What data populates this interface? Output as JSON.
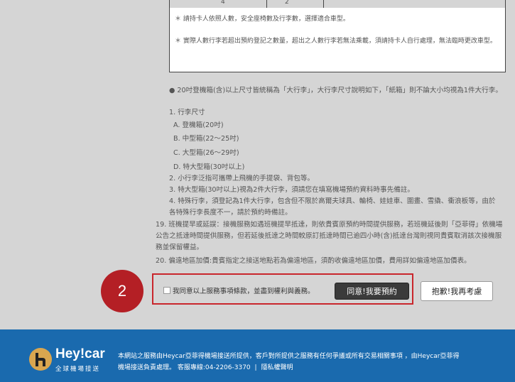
{
  "table": {
    "col2": "4",
    "col3": "2"
  },
  "notices": [
    "＊ 請持卡人依照人數，安全座椅數及行李數，選擇適合車型。",
    "＊ 實際人數行李若超出預約登記之數量，超出之人數行李若無法乘載，須請持卡人自行處理，無法臨時更改車型。"
  ],
  "rules": {
    "luggage_intro": "● 20吋登機箱(含)以上尺寸皆統稱為「大行李」，大行李尺寸說明如下，「紙箱」則不論大小均視為1件大行李。",
    "item1": "1. 行李尺寸",
    "item1a": "A. 登機箱(20吋)",
    "item1b": "B. 中型箱(22～25吋)",
    "item1c": "C. 大型箱(26～29吋)",
    "item1d": "D. 特大型箱(30吋以上)",
    "item2": "2. 小行李泛指可攜帶上飛機的手提袋、背包等。",
    "item3": "3. 特大型箱(30吋以上)視為2件大行李，須請您在填寫機場預約資料時事先備註。",
    "item4": "4. 特殊行李，須登記為1件大行李，包含但不限於高爾夫球具、輪椅、娃娃車、圍畫、雪撬、衝浪板等，由於各特殊行李長度不一，請於預約時備註。",
    "rule19": "19. 班機提早或延誤：接機服務如遇班機提早抵達，則依貴賓原預約時間提供服務，若班機延後則「亞菲得」依機場公告之抵達時間提供服務，但若延後抵達之時間較原訂抵達時間已逾四小時(含)抵達台灣則視同貴賓取消該次接機服務並保留權益。",
    "rule20": "20. 偏遠地區加價:貴賓指定之接送地點若為偏遠地區，須酌收偏遠地區加價，費用詳如偏遠地區加價表。"
  },
  "step_number": "2",
  "agree_label": "我同意以上服務事項條款，並盡到權利與義務。",
  "agree_button": "同意!我要預約",
  "decline_button": "抱歉!我再考慮",
  "footer": {
    "logo_name": "Hey!car",
    "logo_sub": "全球機場接送",
    "text_line1": "本網站之服務由Heycar亞菲得機場接送所提供，客戶對所提供之服務有任何爭議或所有交易相關事項 ，由Heycar亞菲得",
    "text_line2a": "機場接送負責處理。 客服專線:04-2206-3370",
    "text_line2b": "隱私權聲明",
    "separator": "|"
  },
  "colors": {
    "accent_red": "#b41f25",
    "footer_blue": "#1a6aae",
    "logo_gold": "#d9a64f"
  }
}
